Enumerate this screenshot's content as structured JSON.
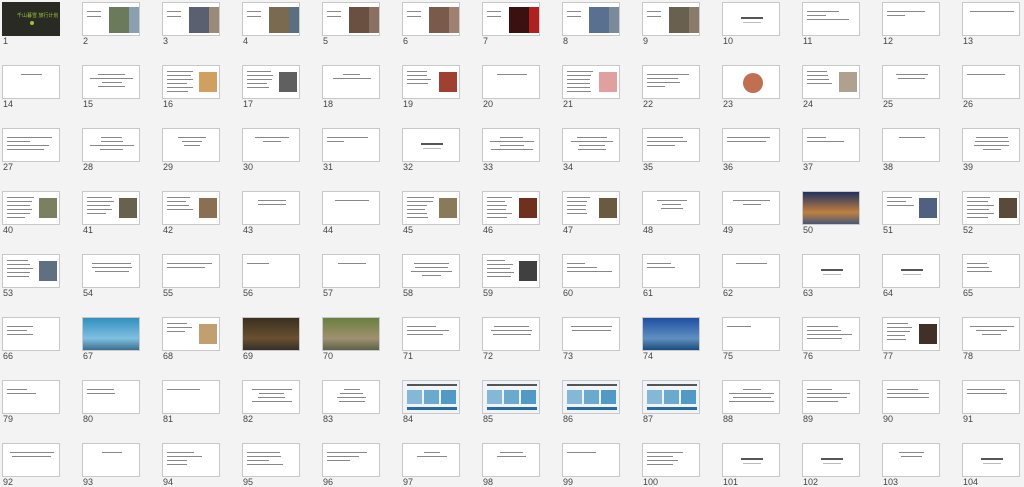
{
  "slides": [
    {
      "n": "1",
      "kind": "cover",
      "text": "千山暮雪 旅行计划"
    },
    {
      "n": "2",
      "kind": "photo",
      "colors": [
        "#6a7a5a",
        "#8aa0b0",
        "#c0b090"
      ]
    },
    {
      "n": "3",
      "kind": "photo",
      "colors": [
        "#5a6070",
        "#9a8a7a",
        "#4a5a6a"
      ]
    },
    {
      "n": "4",
      "kind": "photo",
      "colors": [
        "#7a6a50",
        "#5a7080",
        "#8a7a60"
      ]
    },
    {
      "n": "5",
      "kind": "photo",
      "colors": [
        "#6a5040",
        "#8a7060",
        "#4a4a3a"
      ]
    },
    {
      "n": "6",
      "kind": "photo",
      "colors": [
        "#7a5a4a",
        "#a08070",
        "#5a5050"
      ]
    },
    {
      "n": "7",
      "kind": "photo",
      "colors": [
        "#3a1010",
        "#b02020",
        "#2a0a0a"
      ]
    },
    {
      "n": "8",
      "kind": "photo",
      "colors": [
        "#5a7090",
        "#7a8a9a",
        "#4a5a6a"
      ]
    },
    {
      "n": "9",
      "kind": "photo",
      "colors": [
        "#6a6050",
        "#8a7a6a",
        "#5a5a50"
      ]
    },
    {
      "n": "10",
      "kind": "title"
    },
    {
      "n": "11",
      "kind": "text"
    },
    {
      "n": "12",
      "kind": "text"
    },
    {
      "n": "13",
      "kind": "text"
    },
    {
      "n": "14",
      "kind": "text"
    },
    {
      "n": "15",
      "kind": "text"
    },
    {
      "n": "16",
      "kind": "textimg",
      "colors": [
        "#d0a060"
      ]
    },
    {
      "n": "17",
      "kind": "textimg",
      "colors": [
        "#606060"
      ]
    },
    {
      "n": "18",
      "kind": "text"
    },
    {
      "n": "19",
      "kind": "textimg",
      "colors": [
        "#a04030"
      ]
    },
    {
      "n": "20",
      "kind": "text"
    },
    {
      "n": "21",
      "kind": "textimg",
      "colors": [
        "#e0a0a0"
      ]
    },
    {
      "n": "22",
      "kind": "text"
    },
    {
      "n": "23",
      "kind": "round",
      "colors": [
        "#c07050"
      ]
    },
    {
      "n": "24",
      "kind": "textimg",
      "colors": [
        "#b0a090"
      ]
    },
    {
      "n": "25",
      "kind": "text"
    },
    {
      "n": "26",
      "kind": "text"
    },
    {
      "n": "27",
      "kind": "text"
    },
    {
      "n": "28",
      "kind": "text"
    },
    {
      "n": "29",
      "kind": "text"
    },
    {
      "n": "30",
      "kind": "text"
    },
    {
      "n": "31",
      "kind": "text"
    },
    {
      "n": "32",
      "kind": "title"
    },
    {
      "n": "33",
      "kind": "text"
    },
    {
      "n": "34",
      "kind": "text"
    },
    {
      "n": "35",
      "kind": "text"
    },
    {
      "n": "36",
      "kind": "text"
    },
    {
      "n": "37",
      "kind": "text"
    },
    {
      "n": "38",
      "kind": "text"
    },
    {
      "n": "39",
      "kind": "text"
    },
    {
      "n": "40",
      "kind": "textimg",
      "colors": [
        "#7a8060"
      ]
    },
    {
      "n": "41",
      "kind": "textimg",
      "colors": [
        "#6a6050"
      ]
    },
    {
      "n": "42",
      "kind": "textimg",
      "colors": [
        "#8a7050"
      ]
    },
    {
      "n": "43",
      "kind": "text"
    },
    {
      "n": "44",
      "kind": "text"
    },
    {
      "n": "45",
      "kind": "textimg",
      "colors": [
        "#8a7a5a"
      ]
    },
    {
      "n": "46",
      "kind": "textimg",
      "colors": [
        "#703020"
      ]
    },
    {
      "n": "47",
      "kind": "textimg",
      "colors": [
        "#6a5a40"
      ]
    },
    {
      "n": "48",
      "kind": "text"
    },
    {
      "n": "49",
      "kind": "text"
    },
    {
      "n": "50",
      "kind": "photo",
      "colors": [
        "#203060",
        "#c08040",
        "#305080"
      ]
    },
    {
      "n": "51",
      "kind": "textimg",
      "colors": [
        "#506080"
      ]
    },
    {
      "n": "52",
      "kind": "textimg",
      "colors": [
        "#5a4a3a"
      ]
    },
    {
      "n": "53",
      "kind": "textimg",
      "colors": [
        "#607080"
      ]
    },
    {
      "n": "54",
      "kind": "text"
    },
    {
      "n": "55",
      "kind": "text"
    },
    {
      "n": "56",
      "kind": "text"
    },
    {
      "n": "57",
      "kind": "text"
    },
    {
      "n": "58",
      "kind": "text"
    },
    {
      "n": "59",
      "kind": "textimg",
      "colors": [
        "#404040"
      ]
    },
    {
      "n": "60",
      "kind": "text"
    },
    {
      "n": "61",
      "kind": "text"
    },
    {
      "n": "62",
      "kind": "text"
    },
    {
      "n": "63",
      "kind": "title"
    },
    {
      "n": "64",
      "kind": "title"
    },
    {
      "n": "65",
      "kind": "text"
    },
    {
      "n": "66",
      "kind": "text"
    },
    {
      "n": "67",
      "kind": "photo",
      "colors": [
        "#3090c0",
        "#80c0e0",
        "#306080"
      ]
    },
    {
      "n": "68",
      "kind": "textimg",
      "colors": [
        "#c0a070"
      ]
    },
    {
      "n": "69",
      "kind": "photo",
      "colors": [
        "#3a3020",
        "#6a5030",
        "#2a2a2a"
      ]
    },
    {
      "n": "70",
      "kind": "photo",
      "colors": [
        "#6a8040",
        "#a09070",
        "#505a40"
      ]
    },
    {
      "n": "71",
      "kind": "text"
    },
    {
      "n": "72",
      "kind": "text"
    },
    {
      "n": "73",
      "kind": "text"
    },
    {
      "n": "74",
      "kind": "photo",
      "colors": [
        "#2050a0",
        "#6090c0",
        "#104070"
      ]
    },
    {
      "n": "75",
      "kind": "text"
    },
    {
      "n": "76",
      "kind": "text"
    },
    {
      "n": "77",
      "kind": "textimg",
      "colors": [
        "#403028"
      ]
    },
    {
      "n": "78",
      "kind": "text"
    },
    {
      "n": "79",
      "kind": "text"
    },
    {
      "n": "80",
      "kind": "text"
    },
    {
      "n": "81",
      "kind": "text"
    },
    {
      "n": "82",
      "kind": "text"
    },
    {
      "n": "83",
      "kind": "text"
    },
    {
      "n": "84",
      "kind": "panel",
      "colors": [
        "#4090c0"
      ]
    },
    {
      "n": "85",
      "kind": "panel",
      "colors": [
        "#4090c0"
      ]
    },
    {
      "n": "86",
      "kind": "panel",
      "colors": [
        "#4090c0"
      ]
    },
    {
      "n": "87",
      "kind": "panel",
      "colors": [
        "#4090c0"
      ]
    },
    {
      "n": "88",
      "kind": "text"
    },
    {
      "n": "89",
      "kind": "text"
    },
    {
      "n": "90",
      "kind": "text"
    },
    {
      "n": "91",
      "kind": "text"
    },
    {
      "n": "92",
      "kind": "text"
    },
    {
      "n": "93",
      "kind": "text"
    },
    {
      "n": "94",
      "kind": "text"
    },
    {
      "n": "95",
      "kind": "text"
    },
    {
      "n": "96",
      "kind": "text"
    },
    {
      "n": "97",
      "kind": "text"
    },
    {
      "n": "98",
      "kind": "text"
    },
    {
      "n": "99",
      "kind": "text"
    },
    {
      "n": "100",
      "kind": "text"
    },
    {
      "n": "101",
      "kind": "title"
    },
    {
      "n": "102",
      "kind": "title"
    },
    {
      "n": "103",
      "kind": "text"
    },
    {
      "n": "104",
      "kind": "title"
    }
  ]
}
